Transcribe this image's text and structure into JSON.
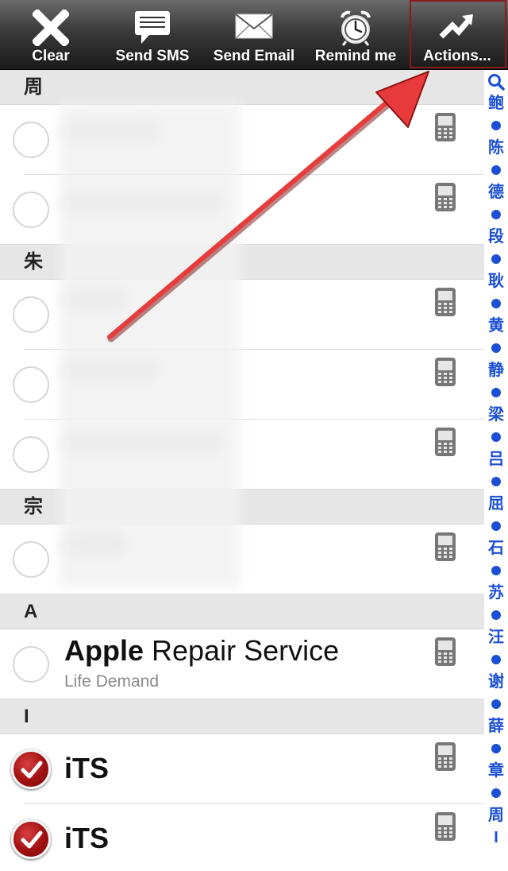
{
  "toolbar": {
    "clear_label": "Clear",
    "sms_label": "Send SMS",
    "email_label": "Send Email",
    "remind_label": "Remind me",
    "actions_label": "Actions..."
  },
  "sections": [
    {
      "header": "周"
    },
    {
      "header": "朱"
    },
    {
      "header": "宗"
    },
    {
      "header": "A"
    },
    {
      "header": "I"
    }
  ],
  "contacts": {
    "apple": {
      "bold": "Apple",
      "rest": " Repair Service",
      "subtitle": "Life Demand"
    },
    "its1": {
      "name": "iTS"
    },
    "its2": {
      "name": "iTS"
    }
  },
  "index": [
    "鲍",
    "陈",
    "德",
    "段",
    "耿",
    "黄",
    "静",
    "梁",
    "吕",
    "屈",
    "石",
    "苏",
    "汪",
    "谢",
    "薛",
    "章",
    "周",
    "I"
  ],
  "colors": {
    "accent": "#1a4fd6",
    "check_red": "#a01010",
    "annotation_arrow": "#e83a3a",
    "highlight_border": "#8a1a1a"
  }
}
